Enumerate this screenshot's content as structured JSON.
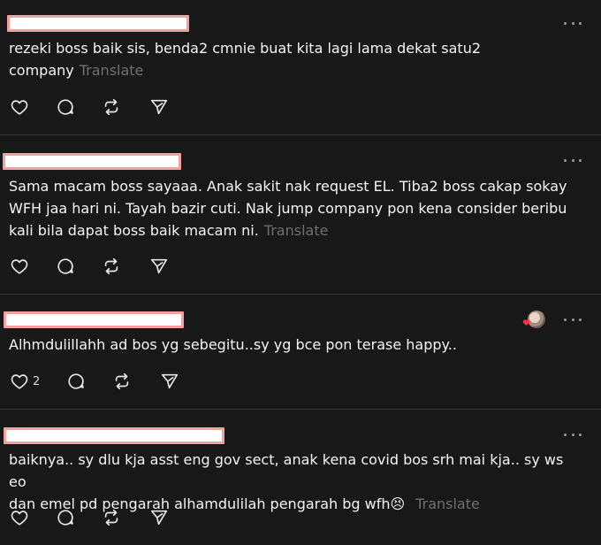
{
  "theme": {
    "background": "#181818",
    "text": "#f3f5f7",
    "muted": "#6f6f6f",
    "separator": "#333638",
    "like_badge": "#ff3040"
  },
  "icons": {
    "like": "heart-icon",
    "reply": "comment-icon",
    "repost": "repost-icon",
    "share": "send-icon",
    "more": "more-dots-icon"
  },
  "posts": [
    {
      "text": "rezeki boss baik sis, benda2 cmnie buat kita lagi lama dekat satu2\ncompany",
      "translate": "Translate",
      "likes": ""
    },
    {
      "text": "Sama macam boss sayaaa. Anak sakit nak request EL. Tiba2 boss cakap sokay\nWFH jaa hari ni. Tayah bazir cuti. Nak jump company pon kena consider beribu\nkali bila dapat boss baik macam ni.",
      "translate": "Translate",
      "likes": ""
    },
    {
      "text": "Alhmdulillahh ad bos yg sebegitu..sy yg bce pon terase happy..",
      "translate": "",
      "likes": "2"
    },
    {
      "text": "baiknya.. sy dlu kja asst eng gov sect, anak kena covid bos srh mai kja.. sy ws eo\ndan emel pd pengarah alhamdulilah pengarah bg wfh😣",
      "translate": "Translate",
      "likes": ""
    }
  ]
}
